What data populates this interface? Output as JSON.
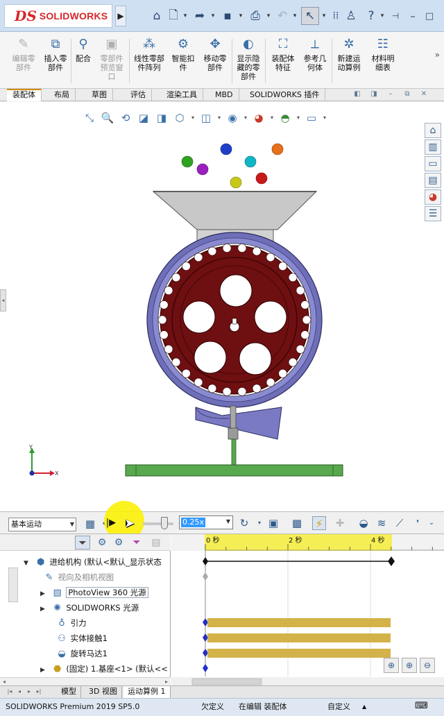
{
  "app": {
    "logo_ds": "DS",
    "logo_text": "SOLIDWORKS",
    "menu_arrow": "▶"
  },
  "quick_access": {
    "icons": [
      "home-icon",
      "new-document-icon",
      "open-icon",
      "save-icon",
      "print-icon",
      "undo-icon",
      "select-icon",
      "rebuild-icon",
      "user-icon",
      "help-icon"
    ]
  },
  "ribbon": {
    "buttons": [
      {
        "label": "编辑零\n部件",
        "icon": "edit-component-icon",
        "enabled": false
      },
      {
        "label": "插入零\n部件",
        "icon": "insert-components-icon",
        "enabled": true
      },
      {
        "label": "配合",
        "icon": "mate-icon",
        "enabled": true
      },
      {
        "label": "零部件\n预览窗\n口",
        "icon": "component-preview-icon",
        "enabled": false
      },
      {
        "label": "线性零部\n件阵列",
        "icon": "linear-pattern-icon",
        "enabled": true
      },
      {
        "label": "智能扣\n件",
        "icon": "smart-fasteners-icon",
        "enabled": true
      },
      {
        "label": "移动零\n部件",
        "icon": "move-component-icon",
        "enabled": true
      },
      {
        "label": "显示隐\n藏的零\n部件",
        "icon": "show-hidden-icon",
        "enabled": true
      },
      {
        "label": "装配体\n特征",
        "icon": "assembly-features-icon",
        "enabled": true
      },
      {
        "label": "参考几\n何体",
        "icon": "reference-geometry-icon",
        "enabled": true
      },
      {
        "label": "新建运\n动算例",
        "icon": "new-motion-study-icon",
        "enabled": true
      },
      {
        "label": "材料明\n细表",
        "icon": "bom-icon",
        "enabled": true
      }
    ]
  },
  "command_tabs": [
    "装配体",
    "布局",
    "草图",
    "评估",
    "渲染工具",
    "MBD",
    "SOLIDWORKS 插件"
  ],
  "command_tabs_active": 0,
  "motion": {
    "study_type": "基本运动",
    "speed": "0.25x",
    "timeline_labels": [
      "0 秒",
      "2 秒",
      "4 秒"
    ]
  },
  "tree": {
    "nodes": [
      {
        "label": "进给机构  (默认<默认_显示状态",
        "icon": "assembly-icon",
        "expander": "▼",
        "grey": false,
        "boxed": false
      },
      {
        "label": "视向及相机视图",
        "icon": "camera-views-icon",
        "expander": "",
        "grey": true,
        "boxed": false
      },
      {
        "label": "PhotoView 360 光源",
        "icon": "photoview-lights-icon",
        "expander": "▶",
        "grey": false,
        "boxed": true
      },
      {
        "label": "SOLIDWORKS 光源",
        "icon": "lights-icon",
        "expander": "▶",
        "grey": false,
        "boxed": false
      },
      {
        "label": "引力",
        "icon": "gravity-icon",
        "expander": "",
        "grey": false,
        "boxed": false
      },
      {
        "label": "实体接触1",
        "icon": "contact-icon",
        "expander": "",
        "grey": false,
        "boxed": false
      },
      {
        "label": "旋转马达1",
        "icon": "rotary-motor-icon",
        "expander": "",
        "grey": false,
        "boxed": false
      },
      {
        "label": "(固定) 1.基座<1> (默认<<",
        "icon": "part-icon",
        "expander": "▶",
        "grey": false,
        "boxed": false
      }
    ]
  },
  "bottom_tabs": [
    "模型",
    "3D 视图",
    "运动算例 1"
  ],
  "bottom_tabs_active": 2,
  "status": {
    "product": "SOLIDWORKS Premium 2019 SP5.0",
    "definition": "欠定义",
    "mode": "在编辑 装配体",
    "units": "自定义"
  },
  "colors": {
    "title_bar": "#cfe0f2",
    "accent": "#d28b00",
    "timeline_bar": "#d4b24a",
    "timeline_header": "#f5ef55",
    "gear_fill": "#6e0f12",
    "ring_fill": "#6f6fb8",
    "hopper": "#c9c9c9",
    "stand": "#58a84e",
    "balls": [
      "#2fa020",
      "#9a1fbe",
      "#1f3fc8",
      "#0fb6c6",
      "#e8701a",
      "#c8c81a",
      "#c81a1a"
    ]
  }
}
